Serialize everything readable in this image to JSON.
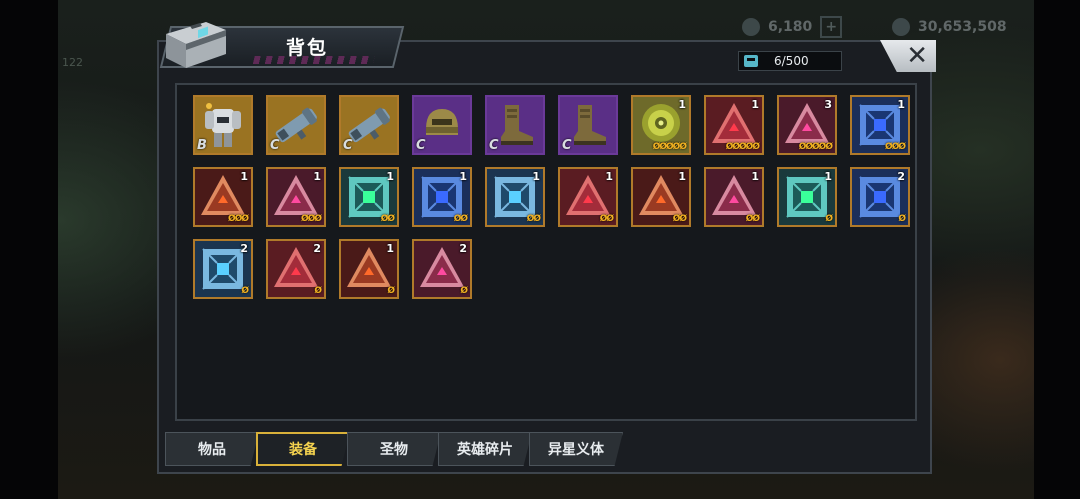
{
  "background": {
    "resource_1": "6,180",
    "resource_2": "30,653,508",
    "side_label": "122"
  },
  "window": {
    "title": "背包",
    "capacity": "6/500",
    "close_icon": "close-x-icon"
  },
  "items": [
    {
      "kind": "armor",
      "grade": "B",
      "count": "",
      "stars": "",
      "bg": "#9a7322",
      "frame": "#b07a2a"
    },
    {
      "kind": "launcher",
      "grade": "C",
      "count": "",
      "stars": "",
      "bg": "#9a7322",
      "frame": "#b07a2a"
    },
    {
      "kind": "launcher",
      "grade": "C",
      "count": "",
      "stars": "",
      "bg": "#9a7322",
      "frame": "#b07a2a"
    },
    {
      "kind": "helmet",
      "grade": "C",
      "count": "",
      "stars": "",
      "bg": "#5a2f86",
      "frame": "#6b3a99"
    },
    {
      "kind": "boots",
      "grade": "C",
      "count": "",
      "stars": "",
      "bg": "#5a2f86",
      "frame": "#6b3a99"
    },
    {
      "kind": "boots",
      "grade": "C",
      "count": "",
      "stars": "",
      "bg": "#5a2f86",
      "frame": "#6b3a99"
    },
    {
      "kind": "disc",
      "grade": "",
      "count": "1",
      "stars": "ØØØØØ",
      "bg": "#6e6a2a",
      "frame": "#b07a2a"
    },
    {
      "kind": "tri-red",
      "grade": "",
      "count": "1",
      "stars": "ØØØØØ",
      "bg": "#5a1c22",
      "frame": "#b07a2a"
    },
    {
      "kind": "tri-pink",
      "grade": "",
      "count": "3",
      "stars": "ØØØØØ",
      "bg": "#4a1a2a",
      "frame": "#b07a2a"
    },
    {
      "kind": "cube-blue",
      "grade": "",
      "count": "1",
      "stars": "ØØØ",
      "bg": "#1b2f5a",
      "frame": "#b07a2a"
    },
    {
      "kind": "tri-orange",
      "grade": "",
      "count": "1",
      "stars": "ØØØ",
      "bg": "#4a1a18",
      "frame": "#b07a2a"
    },
    {
      "kind": "tri-pink",
      "grade": "",
      "count": "1",
      "stars": "ØØØ",
      "bg": "#4a1a2a",
      "frame": "#b07a2a"
    },
    {
      "kind": "cube-teal",
      "grade": "",
      "count": "1",
      "stars": "ØØ",
      "bg": "#1a3a3c",
      "frame": "#b07a2a"
    },
    {
      "kind": "cube-blue",
      "grade": "",
      "count": "1",
      "stars": "ØØ",
      "bg": "#1b2f5a",
      "frame": "#b07a2a"
    },
    {
      "kind": "cube-sky",
      "grade": "",
      "count": "1",
      "stars": "ØØ",
      "bg": "#1b3550",
      "frame": "#b07a2a"
    },
    {
      "kind": "tri-red",
      "grade": "",
      "count": "1",
      "stars": "ØØ",
      "bg": "#5a1c22",
      "frame": "#b07a2a"
    },
    {
      "kind": "tri-orange",
      "grade": "",
      "count": "1",
      "stars": "ØØ",
      "bg": "#4a1a18",
      "frame": "#b07a2a"
    },
    {
      "kind": "tri-pink",
      "grade": "",
      "count": "1",
      "stars": "ØØ",
      "bg": "#4a1a2a",
      "frame": "#b07a2a"
    },
    {
      "kind": "cube-teal",
      "grade": "",
      "count": "1",
      "stars": "Ø",
      "bg": "#1a3a3c",
      "frame": "#b07a2a"
    },
    {
      "kind": "cube-blue",
      "grade": "",
      "count": "2",
      "stars": "Ø",
      "bg": "#1b2f5a",
      "frame": "#b07a2a"
    },
    {
      "kind": "cube-sky",
      "grade": "",
      "count": "2",
      "stars": "Ø",
      "bg": "#1b3550",
      "frame": "#b07a2a"
    },
    {
      "kind": "tri-red",
      "grade": "",
      "count": "2",
      "stars": "Ø",
      "bg": "#5a1c22",
      "frame": "#b07a2a"
    },
    {
      "kind": "tri-orange",
      "grade": "",
      "count": "1",
      "stars": "Ø",
      "bg": "#4a1a18",
      "frame": "#b07a2a"
    },
    {
      "kind": "tri-pink",
      "grade": "",
      "count": "2",
      "stars": "Ø",
      "bg": "#4a1a2a",
      "frame": "#b07a2a"
    }
  ],
  "tabs": [
    {
      "label": "物品",
      "active": false
    },
    {
      "label": "装备",
      "active": true
    },
    {
      "label": "圣物",
      "active": false
    },
    {
      "label": "英雄碎片",
      "active": false
    },
    {
      "label": "异星义体",
      "active": false
    }
  ],
  "colors": {
    "accent_gold": "#d9b13a",
    "frame_gold": "#b07a2a",
    "panel": "#1a1d22"
  }
}
